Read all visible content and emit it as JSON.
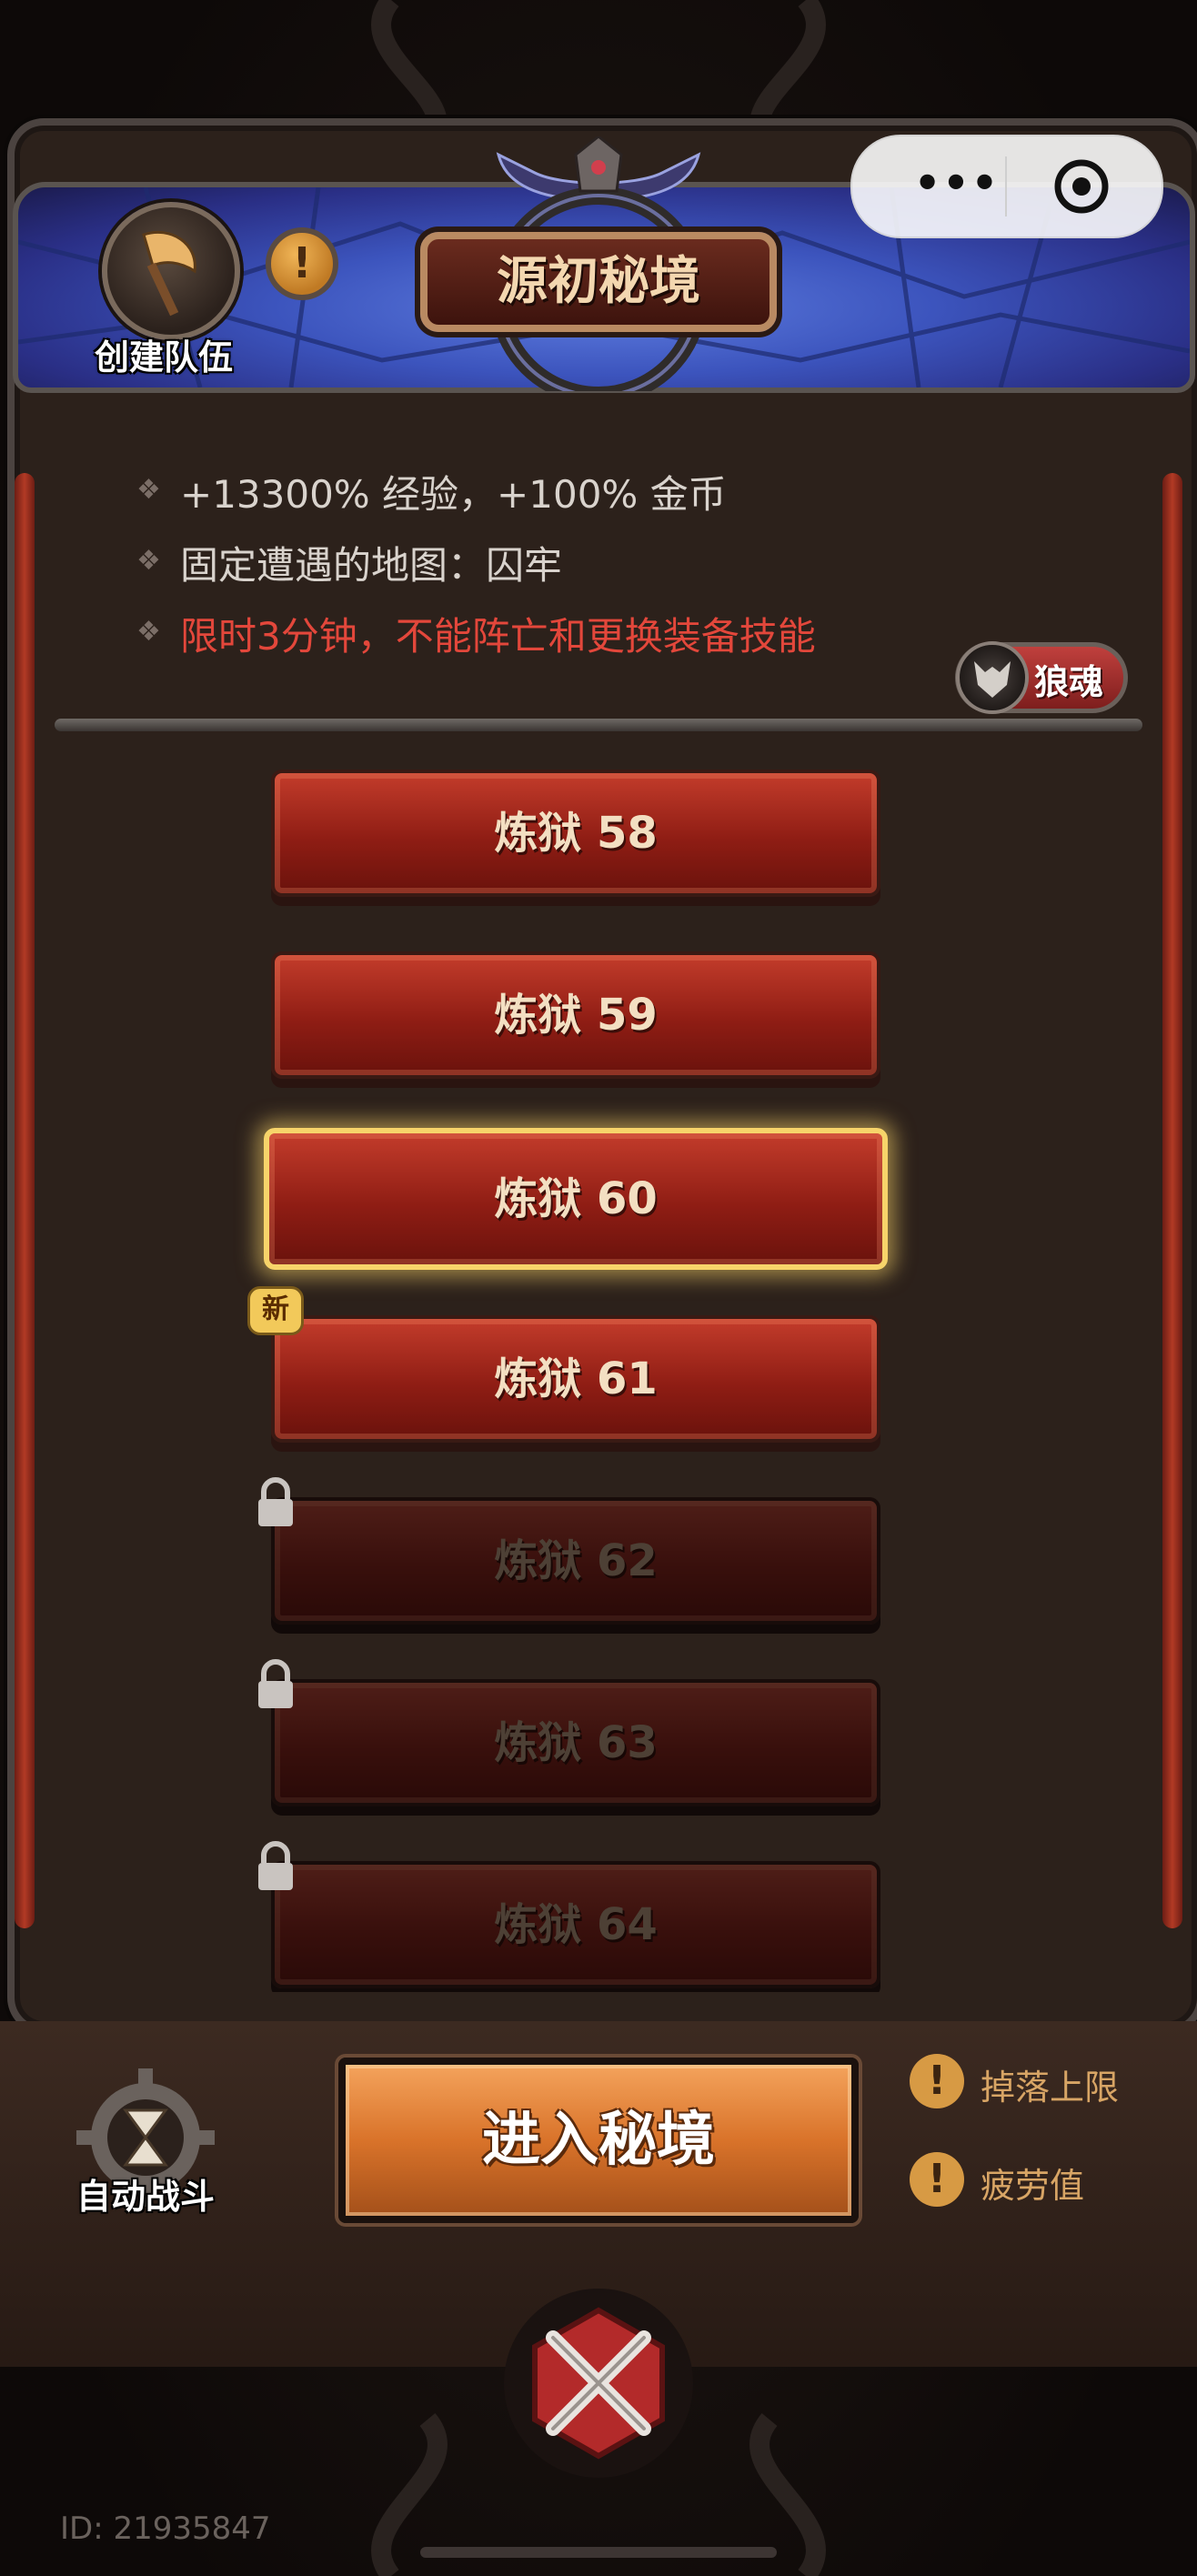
{
  "header": {
    "title": "源初秘境",
    "team_button_label": "创建队伍",
    "info_icon": "exclamation-icon"
  },
  "capsule": {
    "more_label": "•••",
    "close_icon": "target-circle-icon"
  },
  "rules": [
    {
      "text": "+13300% 经验，+100% 金币",
      "style": "normal"
    },
    {
      "text": "固定遭遇的地图：囚牢",
      "style": "normal"
    },
    {
      "text": "限时3分钟，不能阵亡和更换装备技能",
      "style": "warning"
    }
  ],
  "wolf_badge_label": "狼魂",
  "levels": [
    {
      "label": "炼狱 58",
      "state": "unlocked"
    },
    {
      "label": "炼狱 59",
      "state": "unlocked"
    },
    {
      "label": "炼狱 60",
      "state": "selected"
    },
    {
      "label": "炼狱 61",
      "state": "new"
    },
    {
      "label": "炼狱 62",
      "state": "locked"
    },
    {
      "label": "炼狱 63",
      "state": "locked"
    },
    {
      "label": "炼狱 64",
      "state": "locked"
    }
  ],
  "new_badge_label": "新",
  "bottom": {
    "auto_battle_label": "自动战斗",
    "enter_button_label": "进入秘境",
    "drop_limit_label": "掉落上限",
    "fatigue_label": "疲劳值"
  },
  "footer": {
    "user_id": "ID: 21935847"
  },
  "colors": {
    "accent_gold": "#f7d46a",
    "level_red": "#c33c2b",
    "warning_red": "#e3473b",
    "enter_orange": "#d9732a"
  }
}
